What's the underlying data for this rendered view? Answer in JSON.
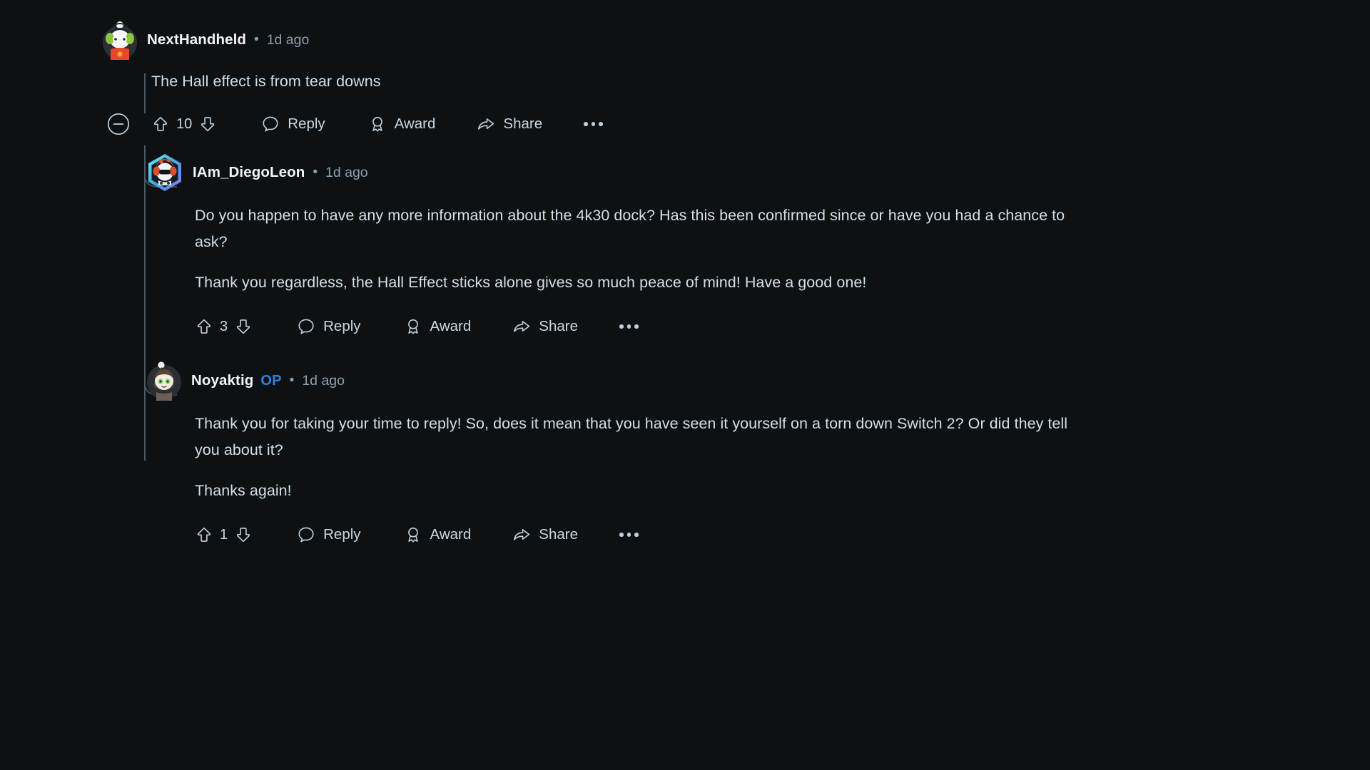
{
  "theme": {
    "background": "#0e1113",
    "text_primary": "#d7dee2",
    "text_secondary": "#8ba2ad",
    "username": "#f2f4f5",
    "op_badge": "#2a85e0",
    "thread_line": "#4a5a63",
    "icon": "#b6c5cd"
  },
  "comments": [
    {
      "id": "comment-nexthandheld",
      "username": "NextHandheld",
      "separator": "•",
      "timestamp": "1d ago",
      "op": false,
      "avatar_name": "avatar-nexthandheld",
      "paragraphs": [
        "The Hall effect is from tear downs"
      ],
      "actions": {
        "collapse_icon": "collapse-minus-icon",
        "upvote_icon": "upvote-arrow-icon",
        "vote_count": "10",
        "downvote_icon": "downvote-arrow-icon",
        "reply_icon": "comment-bubble-icon",
        "reply_label": "Reply",
        "award_icon": "award-ribbon-icon",
        "award_label": "Award",
        "share_icon": "share-arrow-icon",
        "share_label": "Share",
        "overflow_icon": "more-options-icon"
      }
    },
    {
      "id": "comment-iamdiegoleon",
      "username": "IAm_DiegoLeon",
      "separator": "•",
      "timestamp": "1d ago",
      "op": false,
      "avatar_name": "avatar-iamdiegoleon",
      "paragraphs": [
        "Do you happen to have any more information about the 4k30 dock? Has this been confirmed since or have you had a chance to ask?",
        "Thank you regardless, the Hall Effect sticks alone gives so much peace of mind! Have a good one!"
      ],
      "actions": {
        "upvote_icon": "upvote-arrow-icon",
        "vote_count": "3",
        "downvote_icon": "downvote-arrow-icon",
        "reply_icon": "comment-bubble-icon",
        "reply_label": "Reply",
        "award_icon": "award-ribbon-icon",
        "award_label": "Award",
        "share_icon": "share-arrow-icon",
        "share_label": "Share",
        "overflow_icon": "more-options-icon"
      }
    },
    {
      "id": "comment-noyaktig",
      "username": "Noyaktig",
      "op_label": "OP",
      "separator": "•",
      "timestamp": "1d ago",
      "op": true,
      "avatar_name": "avatar-noyaktig",
      "paragraphs": [
        "Thank you for taking your time to reply! So, does it mean that you have seen it yourself on a torn down Switch 2? Or did they tell you about it?",
        "Thanks again!"
      ],
      "actions": {
        "upvote_icon": "upvote-arrow-icon",
        "vote_count": "1",
        "downvote_icon": "downvote-arrow-icon",
        "reply_icon": "comment-bubble-icon",
        "reply_label": "Reply",
        "award_icon": "award-ribbon-icon",
        "award_label": "Award",
        "share_icon": "share-arrow-icon",
        "share_label": "Share",
        "overflow_icon": "more-options-icon"
      }
    }
  ]
}
